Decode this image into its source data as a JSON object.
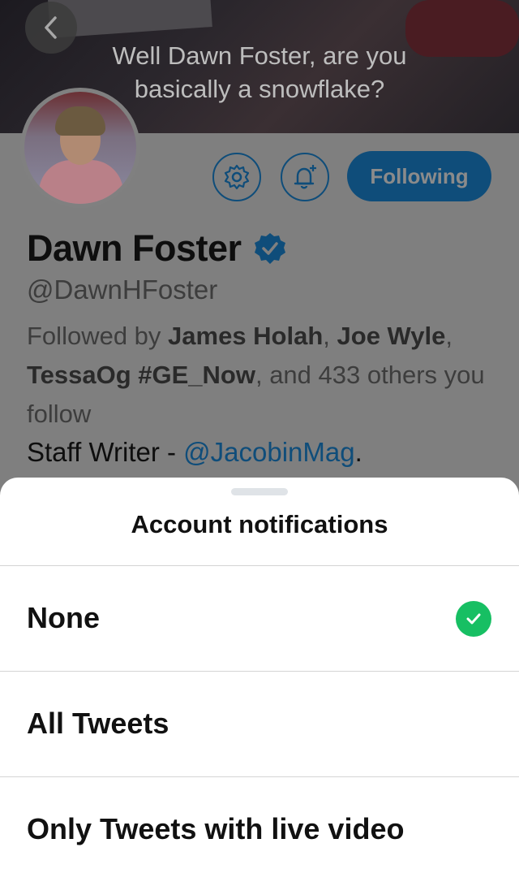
{
  "banner": {
    "line1": "Well Dawn Foster, are you",
    "line2": "basically a snowflake?"
  },
  "profile": {
    "name": "Dawn Foster",
    "handle": "@DawnHFoster",
    "following_label": "Following",
    "followed_prefix": "Followed by ",
    "follower1": "James Holah",
    "sep1": ", ",
    "follower2": "Joe Wyle",
    "sep2": ", ",
    "follower3": "TessaOg #GE_Now",
    "followed_suffix": ", and 433 others you follow",
    "bio_prefix": "Staff Writer - ",
    "bio_link": "@JacobinMag",
    "bio_suffix": "."
  },
  "sheet": {
    "title": "Account notifications",
    "options": [
      {
        "label": "None",
        "selected": true
      },
      {
        "label": "All Tweets",
        "selected": false
      },
      {
        "label": "Only Tweets with live video",
        "selected": false
      }
    ]
  },
  "colors": {
    "accent": "#1da1f2",
    "check": "#17bf63"
  },
  "icons": [
    "back-icon",
    "gear-icon",
    "bell-plus-icon",
    "verified-icon",
    "checkmark-icon"
  ]
}
